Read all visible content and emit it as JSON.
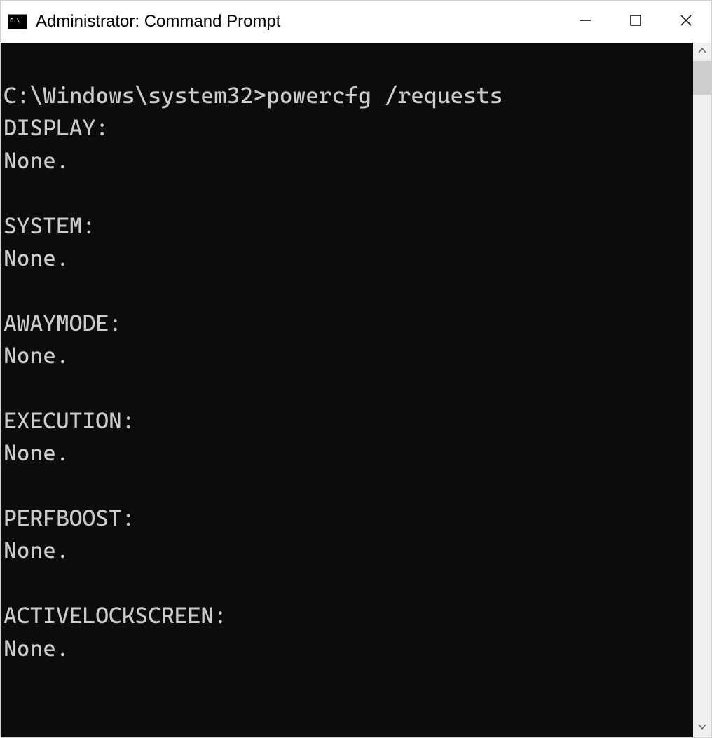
{
  "window": {
    "title": "Administrator: Command Prompt"
  },
  "terminal": {
    "prompt": "C:\\Windows\\system32>",
    "command": "powercfg /requests",
    "sections": [
      {
        "header": "DISPLAY:",
        "value": "None."
      },
      {
        "header": "SYSTEM:",
        "value": "None."
      },
      {
        "header": "AWAYMODE:",
        "value": "None."
      },
      {
        "header": "EXECUTION:",
        "value": "None."
      },
      {
        "header": "PERFBOOST:",
        "value": "None."
      },
      {
        "header": "ACTIVELOCKSCREEN:",
        "value": "None."
      }
    ]
  }
}
